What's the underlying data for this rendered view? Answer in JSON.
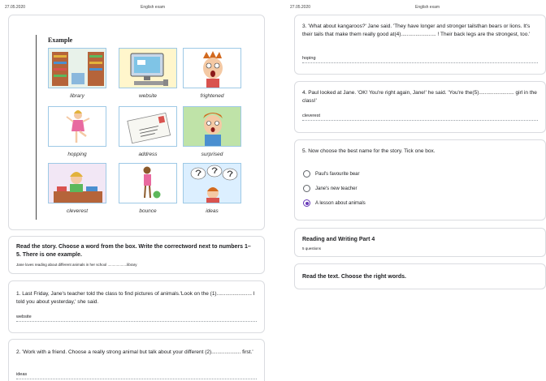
{
  "header": {
    "left_date": "27.05.2020",
    "left_title": "English exam",
    "right_date": "27.05.2020",
    "right_title": "English exam"
  },
  "example": {
    "title": "Example",
    "words": [
      "library",
      "website",
      "frightened",
      "hopping",
      "address",
      "surprised",
      "cleverest",
      "bounce",
      "ideas"
    ]
  },
  "instructions": {
    "title": "Read the story. Choose a word from the box. Write the correctword next to numbers 1– 5. There is one example.",
    "example_line": "Jane loves reading about different animals in her school ...................library"
  },
  "questions": [
    {
      "text": "1. Last Friday, Jane's teacher told the class to find pictures of animals.'Look on the (1)........................ I told you about yesterday,' she said.",
      "answer": "website"
    },
    {
      "text": "2. 'Work with a friend. Choose a really strong animal but talk about your different (2).................... first.'",
      "answer": "ideas"
    },
    {
      "text": "3. 'What about kangaroos?' Jane said. 'They have longer and stronger tailsthan bears or lions. It's their tails that make them really good at(4)........................ ! Their back legs are the strongest, too.'",
      "answer": "hoping"
    },
    {
      "text": "4. Paul looked at Jane. 'OK! You're right again, Jane!' he said. 'You're the(5)........................ girl in the class!'",
      "answer": "cleverest"
    }
  ],
  "q5": {
    "text": "5. Now choose the best name for the story. Tick one box.",
    "options": [
      {
        "label": "Paul's favourite bear",
        "selected": false
      },
      {
        "label": "Jane's new teacher",
        "selected": false
      },
      {
        "label": "A lesson about animals",
        "selected": true
      }
    ]
  },
  "section": {
    "title": "Reading and Writing Part 4",
    "subtitle": "5 questions"
  },
  "read_text": {
    "title": "Read the text. Choose the right words."
  },
  "colors": {
    "accent": "#673ab7",
    "border": "#dadce0"
  }
}
